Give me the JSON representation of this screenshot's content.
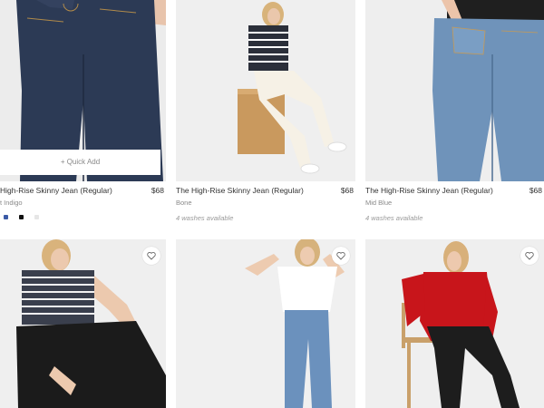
{
  "colors": {
    "accent_swatch_blue": "#3b5aa6",
    "swatch_black": "#111111",
    "swatch_light": "#e6e6e6",
    "text_primary": "#333333",
    "text_muted": "#8a8a8a"
  },
  "products": [
    {
      "name": "High-Rise Skinny Jean (Regular)",
      "price": "$68",
      "color": "t Indigo",
      "quick_add_label": "+ Quick Add",
      "swatches": [
        "#3b5aa6",
        "#111111",
        "#e6e6e6"
      ]
    },
    {
      "name": "The High-Rise Skinny Jean (Regular)",
      "price": "$68",
      "color": "Bone",
      "washes": "4 washes available"
    },
    {
      "name": "The High-Rise Skinny Jean (Regular)",
      "price": "$68",
      "color": "Mid Blue",
      "washes": "4 washes available"
    },
    {
      "wishlist_icon": "heart-icon"
    },
    {
      "wishlist_icon": "heart-icon"
    },
    {
      "wishlist_icon": "heart-icon"
    }
  ]
}
